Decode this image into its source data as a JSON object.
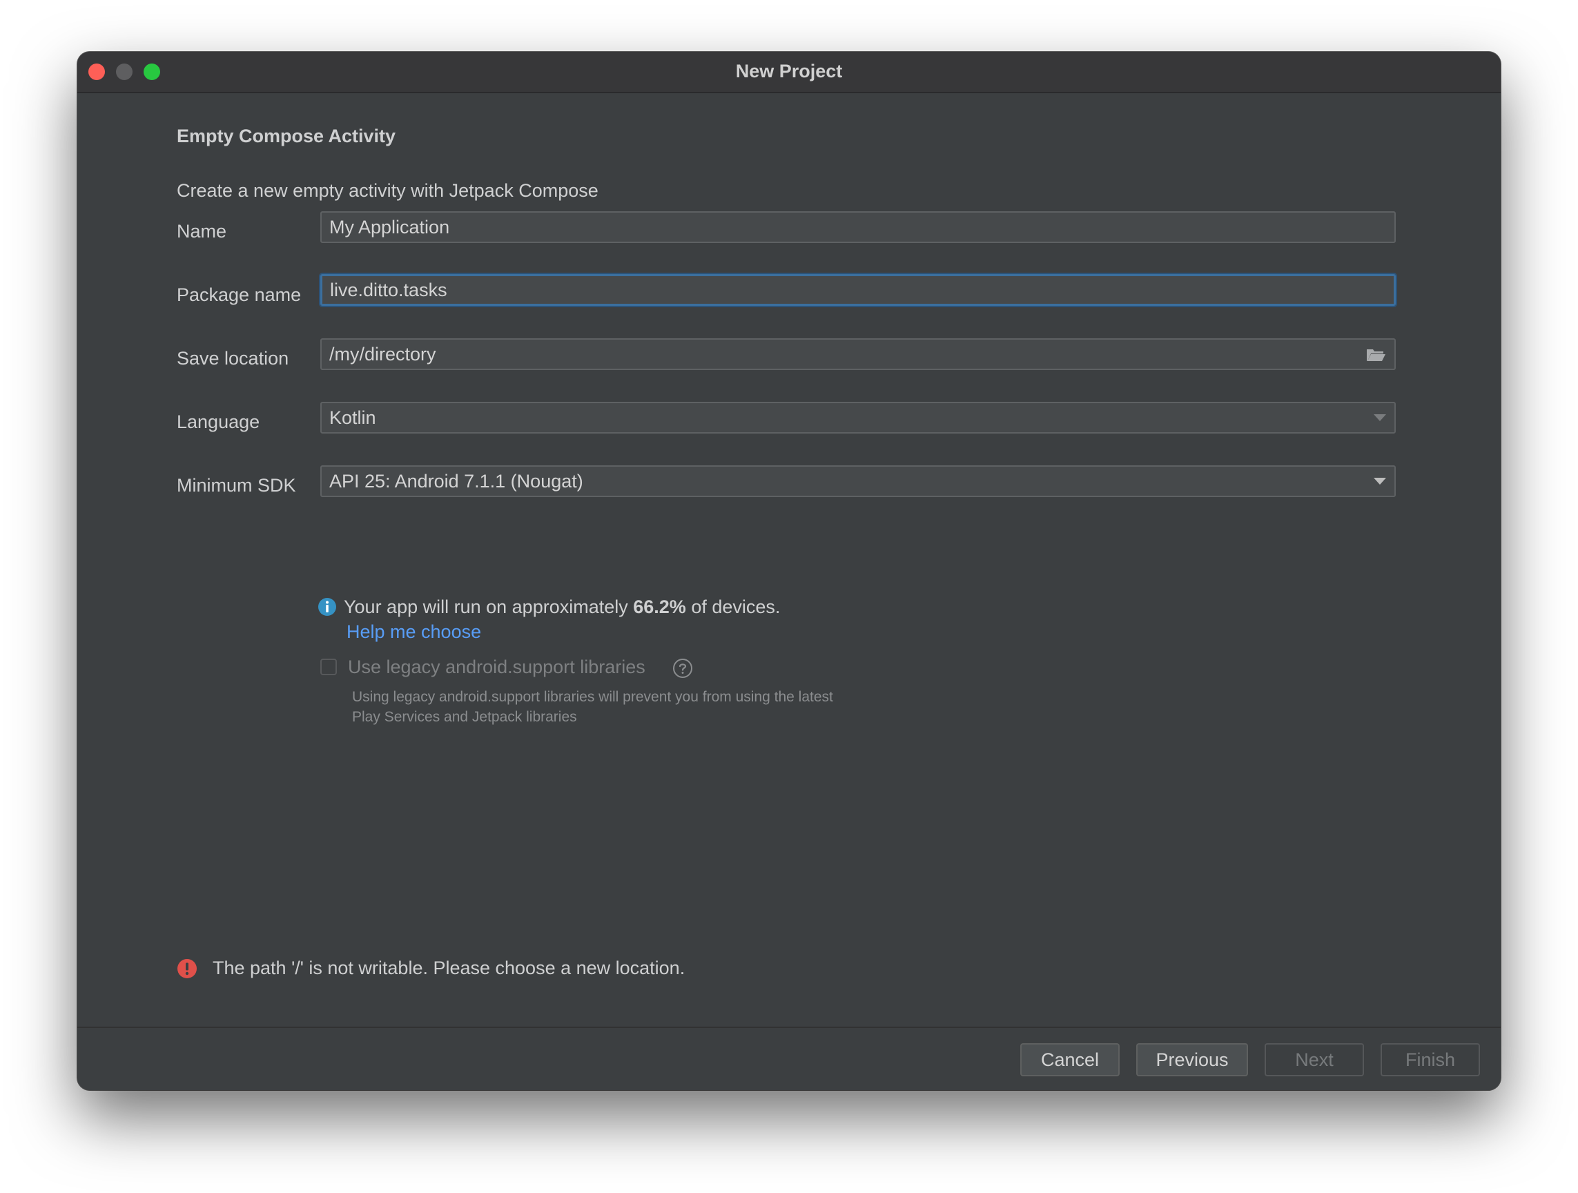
{
  "window": {
    "title": "New Project"
  },
  "template": {
    "heading": "Empty Compose Activity",
    "description": "Create a new empty activity with Jetpack Compose"
  },
  "form": {
    "name": {
      "label": "Name",
      "value": "My Application"
    },
    "package_name": {
      "label": "Package name",
      "value": "live.ditto.tasks"
    },
    "save_location": {
      "label": "Save location",
      "value": "/my/directory"
    },
    "language": {
      "label": "Language",
      "value": "Kotlin"
    },
    "minimum_sdk": {
      "label": "Minimum SDK",
      "value": "API 25: Android 7.1.1 (Nougat)"
    }
  },
  "info": {
    "prefix": "Your app will run on approximately ",
    "percentage": "66.2%",
    "suffix": " of devices.",
    "help_link": "Help me choose"
  },
  "legacy": {
    "label": "Use legacy android.support libraries",
    "checked": false,
    "description": "Using legacy android.support libraries will prevent you from using the latest Play Services and Jetpack libraries"
  },
  "error": {
    "message": "The path '/' is not writable. Please choose a new location."
  },
  "buttons": {
    "cancel": "Cancel",
    "previous": "Previous",
    "next": "Next",
    "finish": "Finish"
  },
  "colors": {
    "window_bg": "#3c3f41",
    "link": "#589df6",
    "error": "#e0504a",
    "info": "#3592c4",
    "focus": "#3b6f9e"
  },
  "icons": {
    "folder": "folder-icon",
    "info": "info-icon",
    "question": "question-icon",
    "error": "error-icon",
    "dropdown": "chevron-down-icon"
  }
}
